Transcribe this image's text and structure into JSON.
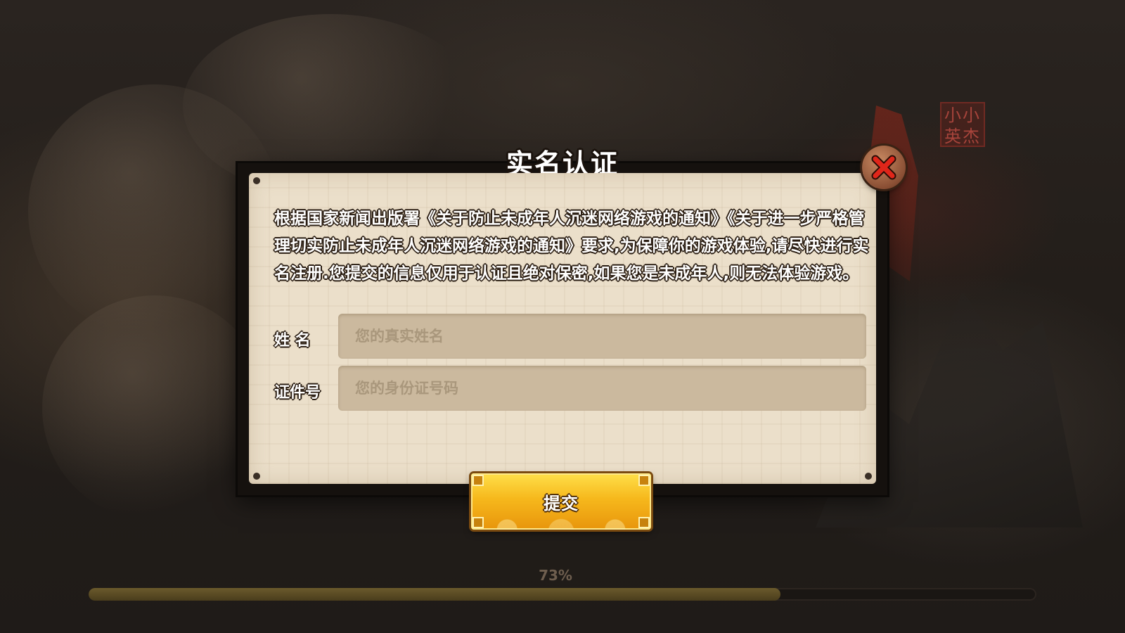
{
  "dialog": {
    "title": "实名认证",
    "notice": "根据国家新闻出版署《关于防止未成年人沉迷网络游戏的通知》《关于进一步严格管理切实防止未成年人沉迷网络游戏的通知》要求,为保障你的游戏体验,请尽快进行实名注册.您提交的信息仅用于认证且绝对保密,如果您是未成年人,则无法体验游戏。",
    "name_label": "姓 名",
    "name_placeholder": "您的真实姓名",
    "id_label": "证件号",
    "id_placeholder": "您的身份证号码",
    "submit_label": "提交",
    "close_icon": "close-icon"
  },
  "background": {
    "stamp_text": "小小英杰"
  },
  "loading": {
    "progress_text": "73%",
    "progress_fraction": 0.73
  },
  "colors": {
    "panel": "#ebdfca",
    "input": "#cbb99e",
    "submit": "#f6b81c",
    "close": "#e0261a"
  }
}
